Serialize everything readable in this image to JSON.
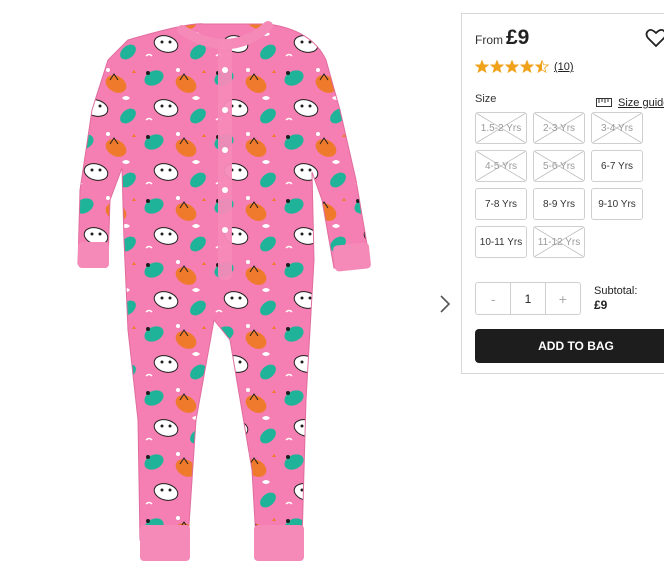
{
  "product": {
    "from_label": "From",
    "price": "£9",
    "review_count": "(10)",
    "rating": 4.5,
    "rating_max": 5
  },
  "sizes": {
    "label": "Size",
    "guide_label": "Size guide",
    "options": [
      {
        "label": "1.5-2 Yrs",
        "available": false
      },
      {
        "label": "2-3 Yrs",
        "available": false
      },
      {
        "label": "3-4 Yrs",
        "available": false
      },
      {
        "label": "4-5 Yrs",
        "available": false
      },
      {
        "label": "5-6 Yrs",
        "available": false
      },
      {
        "label": "6-7 Yrs",
        "available": true
      },
      {
        "label": "7-8 Yrs",
        "available": true
      },
      {
        "label": "8-9 Yrs",
        "available": true
      },
      {
        "label": "9-10 Yrs",
        "available": true
      },
      {
        "label": "10-11 Yrs",
        "available": true
      },
      {
        "label": "11-12 Yrs",
        "available": false
      }
    ]
  },
  "quantity": {
    "minus": "-",
    "value": "1",
    "plus": "+"
  },
  "subtotal": {
    "label": "Subtotal:",
    "value": "£9"
  },
  "cta": {
    "add_to_bag": "ADD TO BAG"
  },
  "colors": {
    "pajama_pink": "#f57fb2",
    "cuff_pink": "#f58ab8",
    "star_gold": "#f0a21b",
    "button_dark": "#1d1d1d"
  }
}
